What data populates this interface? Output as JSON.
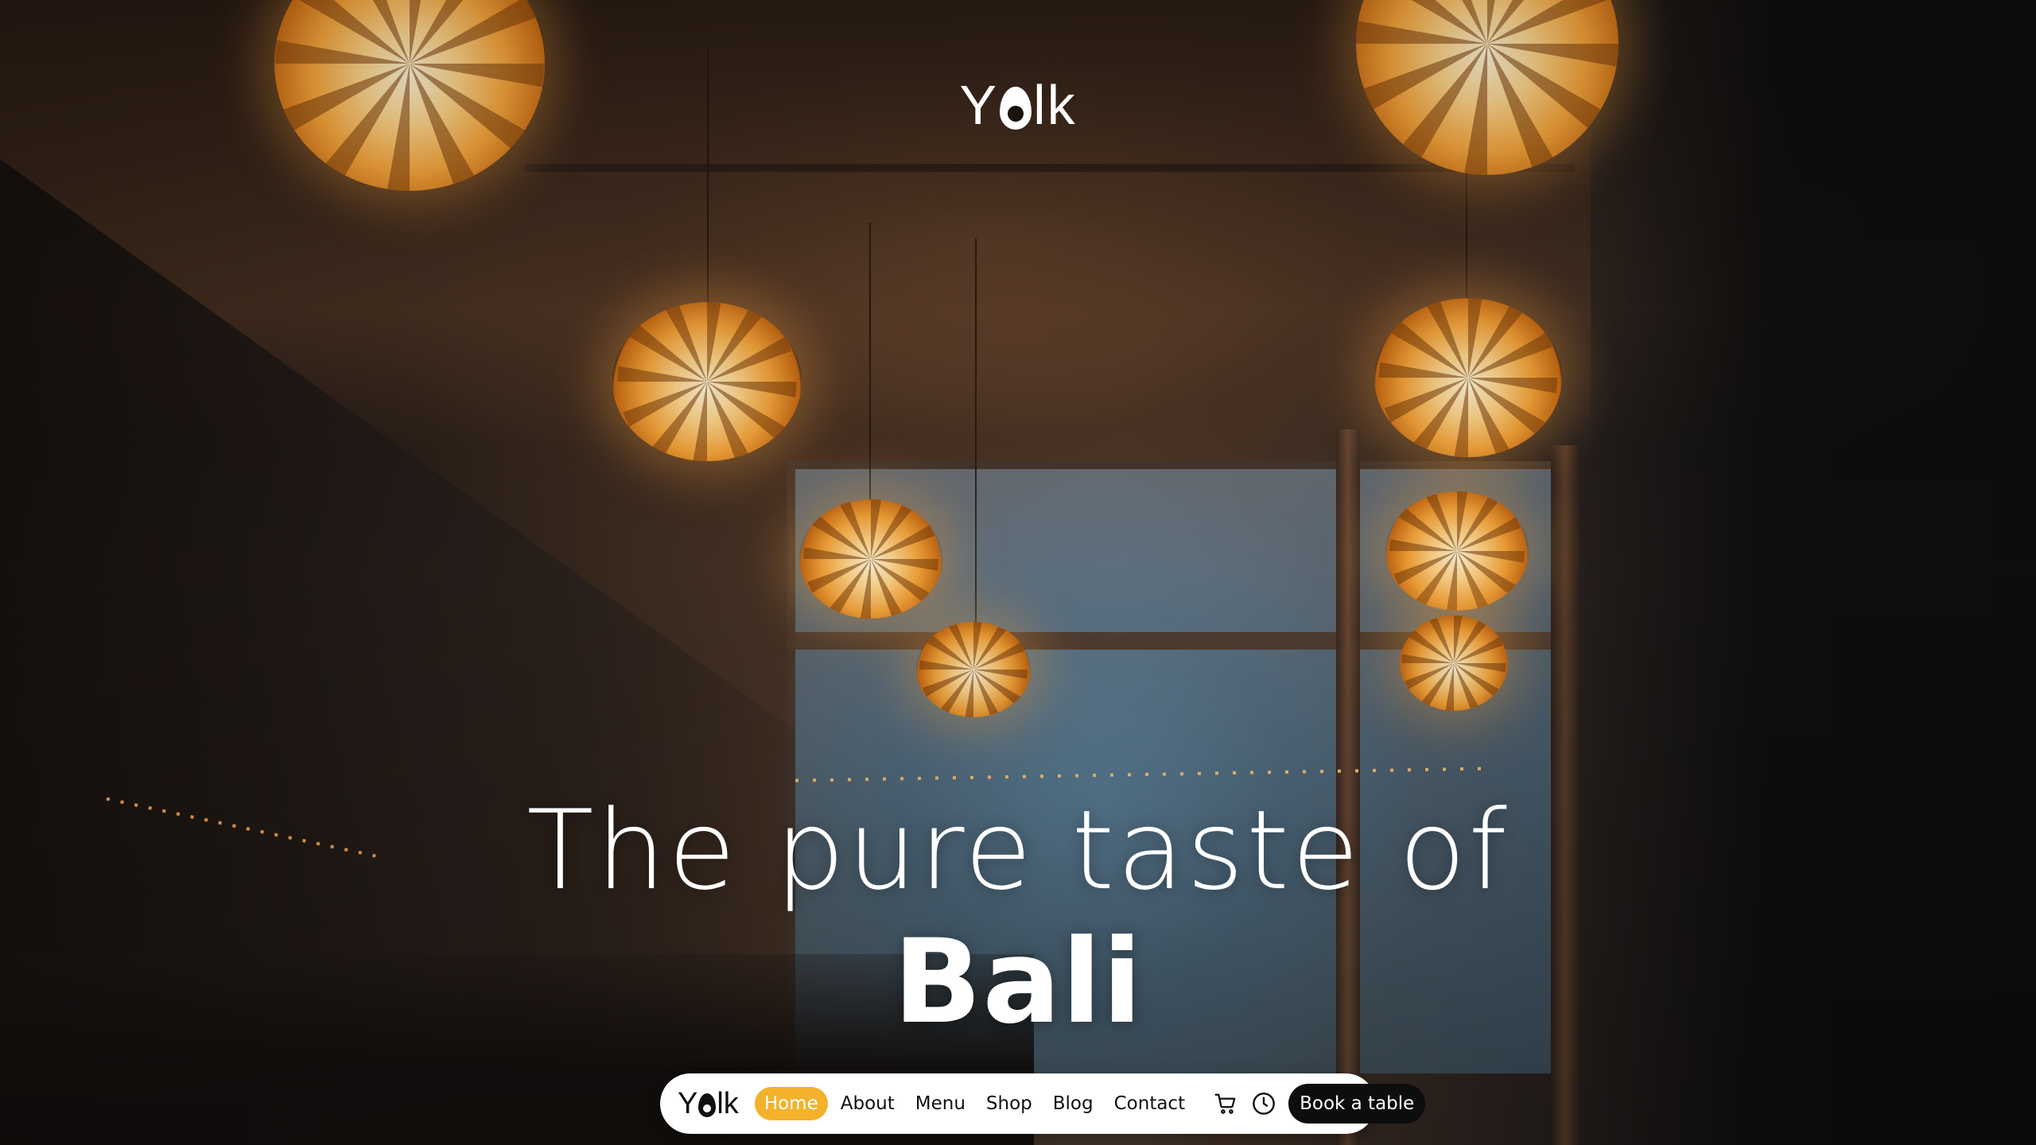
{
  "brand": {
    "logo_prefix": "Y",
    "logo_suffix": "lk",
    "accent_color": "#f4b12b"
  },
  "hero": {
    "headline_line1": "The pure taste of",
    "headline_line2": "Bali"
  },
  "nav": {
    "logo_prefix": "Y",
    "logo_suffix": "lk",
    "links": [
      {
        "label": "Home",
        "active": true
      },
      {
        "label": "About",
        "active": false
      },
      {
        "label": "Menu",
        "active": false
      },
      {
        "label": "Shop",
        "active": false
      },
      {
        "label": "Blog",
        "active": false
      },
      {
        "label": "Contact",
        "active": false
      }
    ],
    "icons": [
      "cart-icon",
      "clock-icon"
    ],
    "cta_label": "Book a table"
  }
}
